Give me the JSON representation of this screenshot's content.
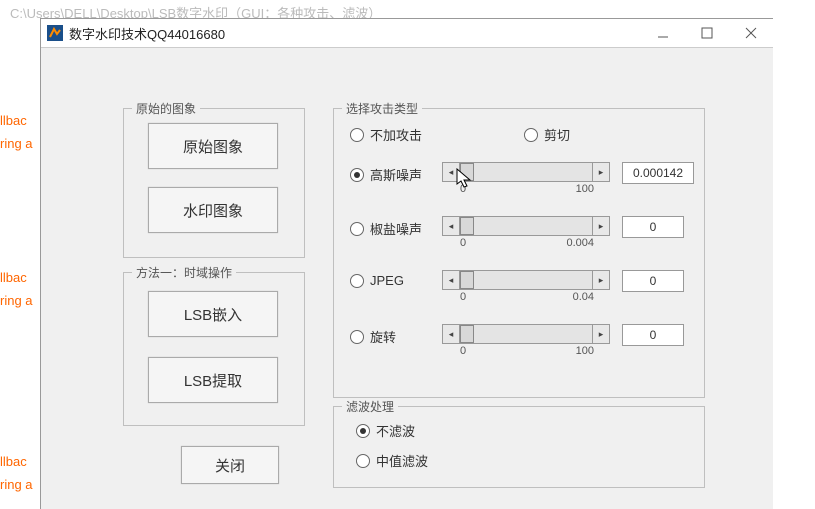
{
  "bg": {
    "path": "C:\\Users\\DELL\\Desktop\\LSB数字水印（GUI：各种攻击、滤波）",
    "snips": [
      "llbac",
      "ring a",
      "llbac",
      "ring a",
      "llbac",
      "ring a"
    ]
  },
  "window": {
    "title": "数字水印技术QQ44016680",
    "min_name": "minimize-icon",
    "max_name": "maximize-icon",
    "close_name": "close-icon"
  },
  "group_original": {
    "legend": "原始的图象",
    "btn_original": "原始图象",
    "btn_watermark": "水印图象"
  },
  "group_method1": {
    "legend": "方法一：时域操作",
    "btn_embed": "LSB嵌入",
    "btn_extract": "LSB提取"
  },
  "close_button": "关闭",
  "group_attack": {
    "legend": "选择攻击类型",
    "r_none": "不加攻击",
    "r_crop": "剪切",
    "r_gauss": "高斯噪声",
    "r_salt": "椒盐噪声",
    "r_jpeg": "JPEG",
    "r_rotate": "旋转",
    "gauss": {
      "min": "0",
      "max": "100",
      "val": "0.000142"
    },
    "salt": {
      "min": "0",
      "max": "0.004",
      "val": "0"
    },
    "jpeg": {
      "min": "0",
      "max": "0.04",
      "val": "0"
    },
    "rotate": {
      "min": "0",
      "max": "100",
      "val": "0"
    }
  },
  "group_filter": {
    "legend": "滤波处理",
    "r_nofilter": "不滤波",
    "r_median": "中值滤波"
  }
}
